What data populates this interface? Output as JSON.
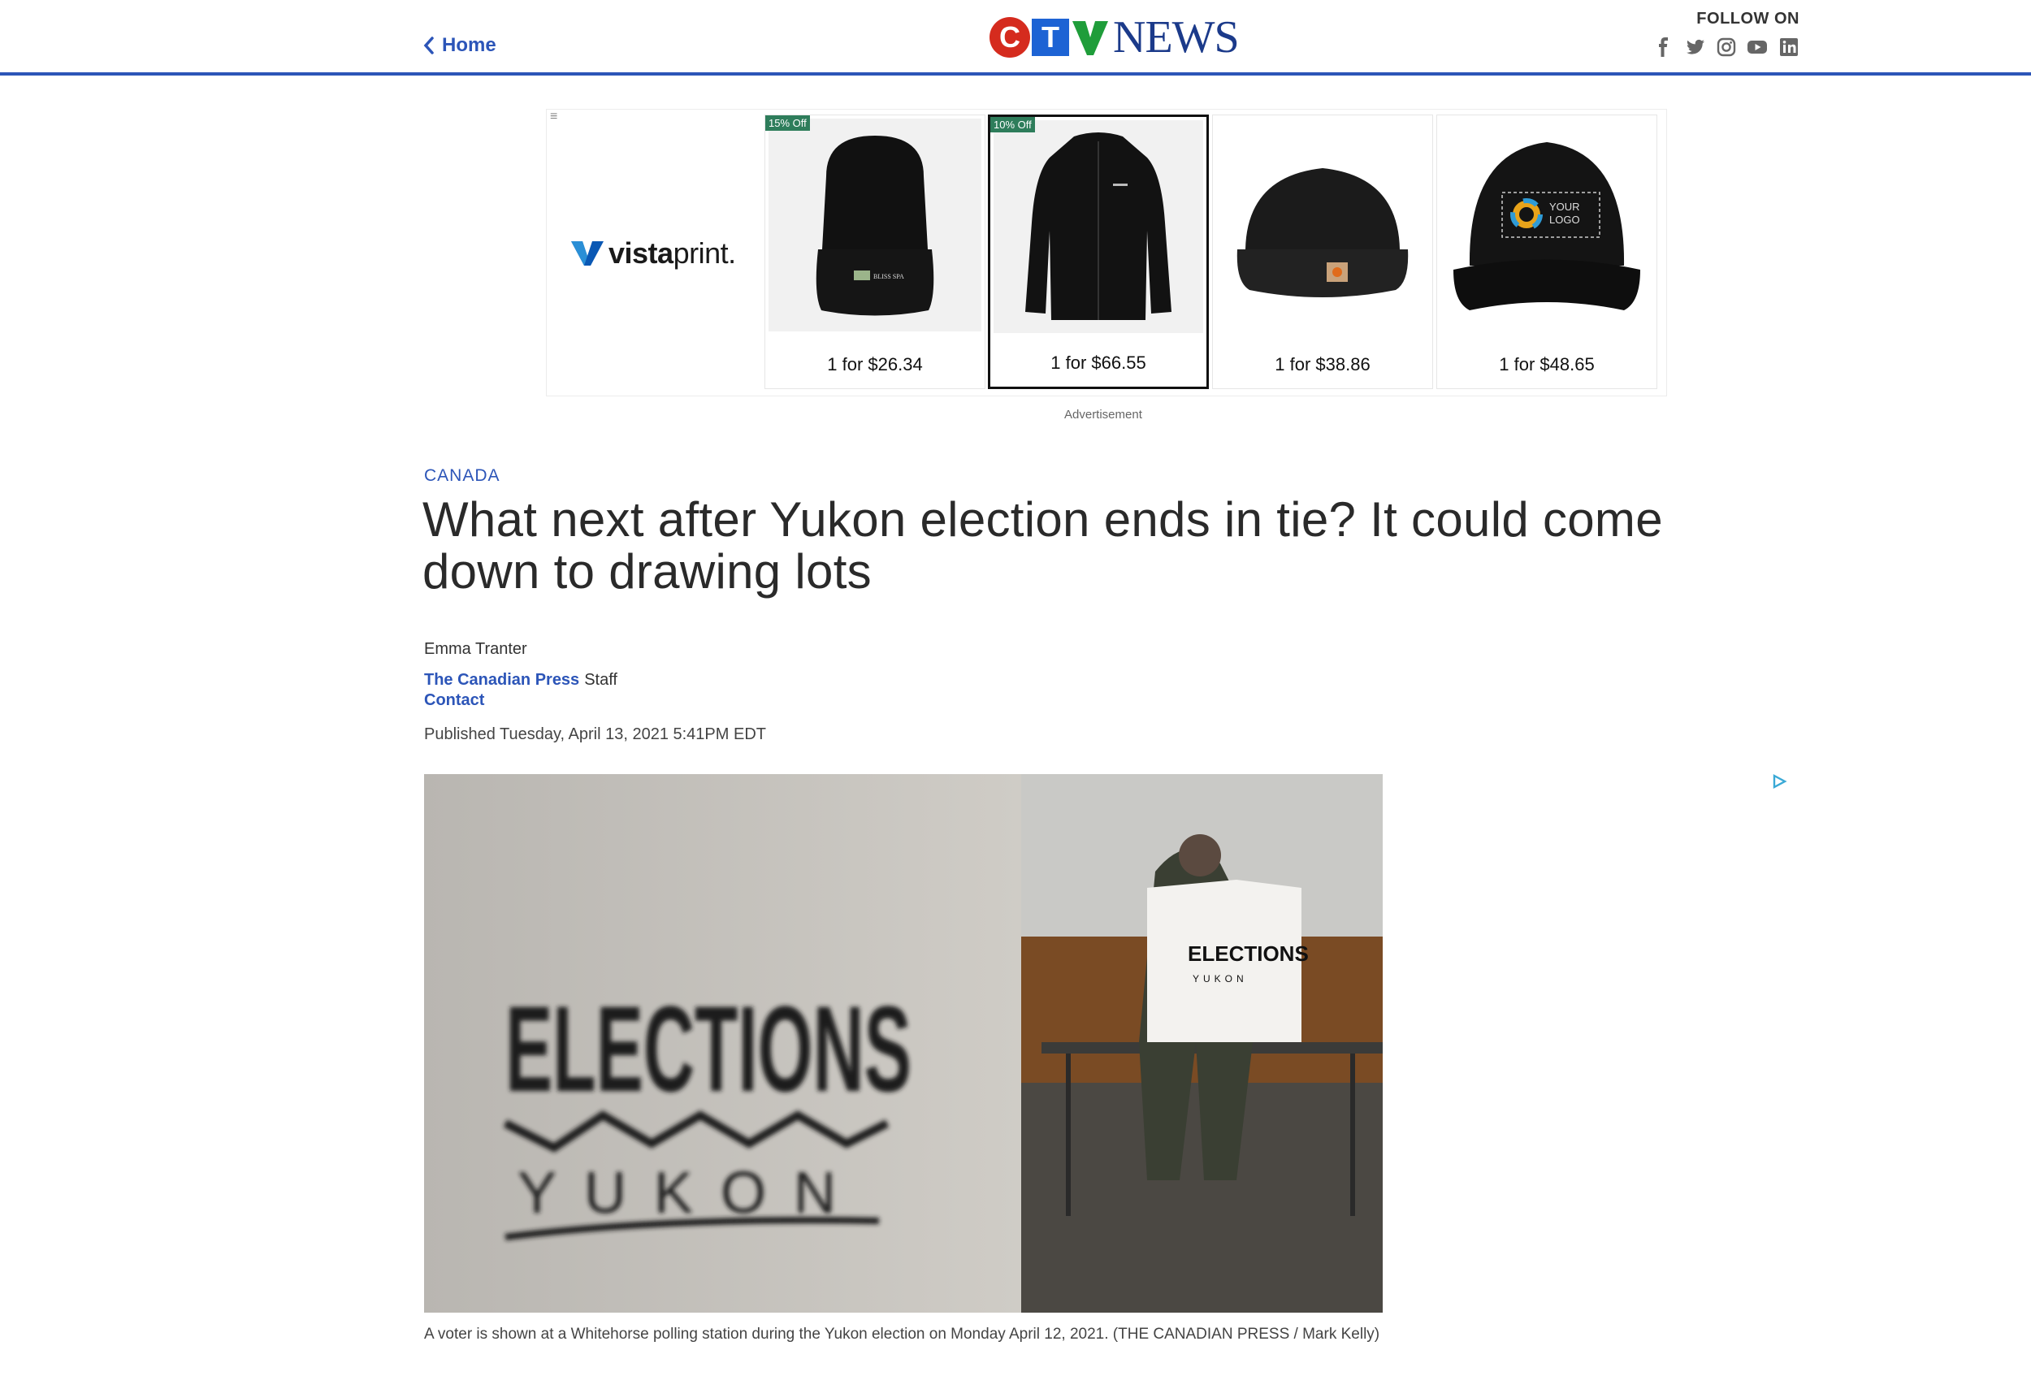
{
  "header": {
    "home_label": "Home",
    "logo_letters": {
      "c": "C",
      "t": "T",
      "v": "V"
    },
    "logo_word": "NEWS",
    "follow_label": "FOLLOW ON",
    "social_icons": [
      "facebook-icon",
      "twitter-icon",
      "instagram-icon",
      "youtube-icon",
      "linkedin-icon"
    ],
    "accent_color": "#2c55b8"
  },
  "ad": {
    "brand_strong": "vista",
    "brand_rest": "print",
    "products": [
      {
        "badge": "15% Off",
        "price": "1 for $26.34",
        "item": "beanie",
        "logo_text": "BLISS SPA"
      },
      {
        "badge": "10% Off",
        "price": "1 for $66.55",
        "item": "fleece-jacket"
      },
      {
        "badge": "",
        "price": "1 for $38.86",
        "item": "carhartt-beanie"
      },
      {
        "badge": "",
        "price": "1 for $48.65",
        "item": "cap",
        "logo_text_1": "YOUR",
        "logo_text_2": "LOGO"
      }
    ],
    "label": "Advertisement"
  },
  "article": {
    "category": "CANADA",
    "headline": "What next after Yukon election ends in tie? It could come down to drawing lots",
    "author": "Emma Tranter",
    "organization": "The Canadian Press",
    "role": "Staff",
    "contact_label": "Contact",
    "published": "Published Tuesday, April 13, 2021 5:41PM EDT",
    "photo": {
      "sign_title": "ELECTIONS",
      "sign_subtitle": "YUKON",
      "caption": "A voter is shown at a Whitehorse polling station during the Yukon election on Monday April 12, 2021. (THE CANADIAN PRESS / Mark Kelly)"
    }
  }
}
